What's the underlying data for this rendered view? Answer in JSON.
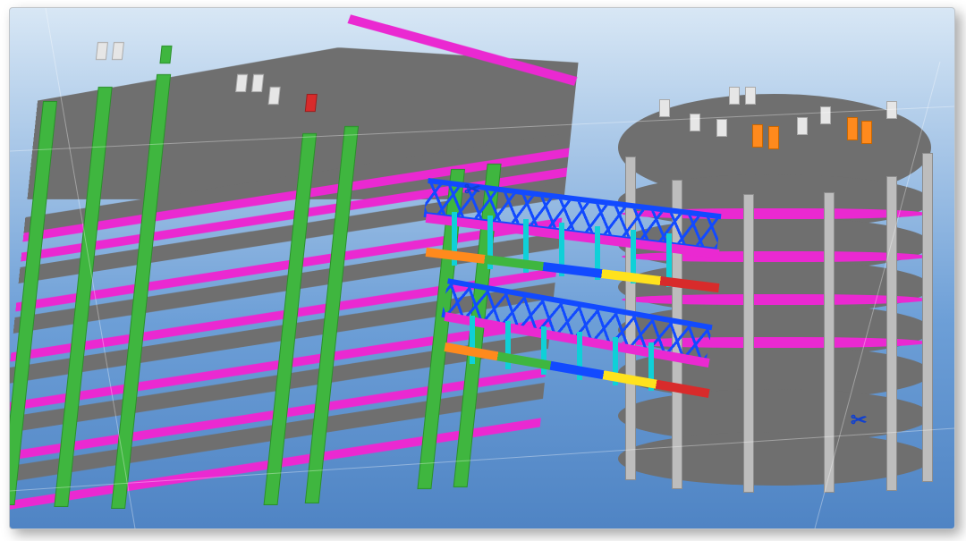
{
  "scene": {
    "description": "3D structural BIM model viewport showing two multi-storey buildings connected by curved link bridges",
    "background_gradient": [
      "#d8e7f5",
      "#4f84c4"
    ]
  },
  "left_building": {
    "floors": 7,
    "column_color": "#3fb63f",
    "slab_color": "#6f6f6f",
    "beam_color": "#ea29d1",
    "roof_stubs": [
      "white",
      "white",
      "white",
      "green",
      "red",
      "white",
      "white"
    ]
  },
  "right_building": {
    "shape": "circular",
    "floors": 8,
    "column_color": "#bdbdbd",
    "slab_color": "#6f6f6f",
    "beam_color": "#ea29d1",
    "roof_stubs": [
      "white",
      "white",
      "orange",
      "white",
      "orange",
      "white",
      "white",
      "white"
    ]
  },
  "link_bridges": {
    "count": 2,
    "truss_color": "#124aff",
    "hanger_color": "#0fd0d8",
    "edge_beam_color": "#ea29d1",
    "deck_member_colors": [
      "#ff8a1d",
      "#3fb63f",
      "#124aff",
      "#ffe21d",
      "#d82b2b"
    ]
  },
  "markers": {
    "glyph": "✂",
    "color": "#1040d0",
    "positions": [
      "upper-bridge-left-end",
      "right-building-lower-right"
    ]
  }
}
